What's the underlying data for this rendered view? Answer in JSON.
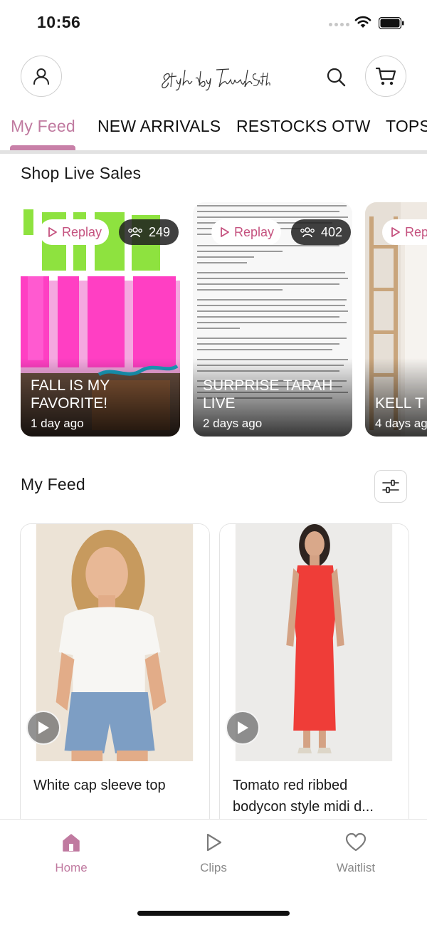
{
  "status_bar": {
    "time": "10:56"
  },
  "header": {
    "logo_text": "Styled by Tarah Sutton",
    "profile_icon": "user-icon",
    "search_icon": "search-icon",
    "cart_icon": "cart-icon"
  },
  "tabs": [
    {
      "label": "My Feed",
      "active": true
    },
    {
      "label": "NEW ARRIVALS",
      "active": false
    },
    {
      "label": "RESTOCKS OTW",
      "active": false
    },
    {
      "label": "TOPS",
      "active": false
    }
  ],
  "live_sales": {
    "title": "Shop Live Sales",
    "replay_label": "Replay",
    "cards": [
      {
        "title": "FALL IS MY FAVORITE!",
        "time": "1 day ago",
        "viewers": "249"
      },
      {
        "title": "SURPRISE TARAH LIVE",
        "time": "2 days ago",
        "viewers": "402"
      },
      {
        "title": "KELL T",
        "time": "4 days ag"
      }
    ]
  },
  "feed": {
    "title": "My Feed",
    "filter_icon": "sliders-icon",
    "products": [
      {
        "name": "White cap sleeve top"
      },
      {
        "name": "Tomato red ribbed bodycon style midi d..."
      }
    ]
  },
  "bottom_nav": [
    {
      "label": "Home",
      "icon": "home-icon",
      "active": true
    },
    {
      "label": "Clips",
      "icon": "play-icon",
      "active": false
    },
    {
      "label": "Waitlist",
      "icon": "heart-icon",
      "active": false
    }
  ],
  "colors": {
    "accent": "#c07aa0",
    "replay_text": "#c5527f",
    "tab_underline": "#c880a8"
  }
}
